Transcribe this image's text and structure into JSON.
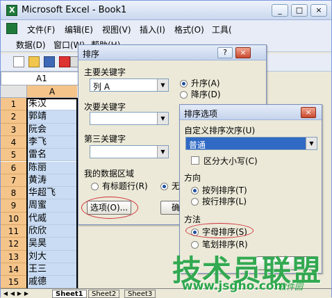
{
  "window": {
    "title": "Microsoft Excel - Book1",
    "caption_buttons": [
      "_",
      "□",
      "×"
    ]
  },
  "menubar": {
    "row1": [
      "文件(F)",
      "编辑(E)",
      "视图(V)",
      "插入(I)",
      "格式(O)",
      "工具("
    ],
    "row2": [
      "数据(D)",
      "窗口(W)",
      "帮助(H)"
    ]
  },
  "namebox": {
    "value": "A1"
  },
  "grid": {
    "column_header": "A",
    "rows": [
      {
        "n": "1",
        "v": "朱汉"
      },
      {
        "n": "2",
        "v": "郭靖"
      },
      {
        "n": "3",
        "v": "阮会"
      },
      {
        "n": "4",
        "v": "李飞"
      },
      {
        "n": "5",
        "v": "雷名"
      },
      {
        "n": "6",
        "v": "陈丽"
      },
      {
        "n": "7",
        "v": "黄涛"
      },
      {
        "n": "8",
        "v": "华超飞"
      },
      {
        "n": "9",
        "v": "周蜜"
      },
      {
        "n": "10",
        "v": "代威"
      },
      {
        "n": "11",
        "v": "欣欣"
      },
      {
        "n": "12",
        "v": "吴昊"
      },
      {
        "n": "13",
        "v": "刘大"
      },
      {
        "n": "14",
        "v": "王三"
      },
      {
        "n": "15",
        "v": "戚德"
      }
    ]
  },
  "sheet_tabs": [
    "Sheet1",
    "Sheet2",
    "Sheet3"
  ],
  "sort_dialog": {
    "title": "排序",
    "title_buttons": [
      "?",
      "×"
    ],
    "primary_key_label": "主要关键字",
    "primary_key_value": "列 A",
    "secondary_key_label": "次要关键字",
    "tertiary_key_label": "第三关键字",
    "asc": "升序(A)",
    "desc": "降序(D)",
    "region_label": "我的数据区域",
    "has_header": "有标题行(R)",
    "no_header": "无标",
    "options_button": "选项(O)...",
    "ok_button": "确定"
  },
  "options_dialog": {
    "title": "排序选项",
    "close": "×",
    "custom_order_label": "自定义排序次序(U)",
    "custom_order_value": "普通",
    "case_sensitive": "区分大小写(C)",
    "direction_label": "方向",
    "by_column": "按列排序(T)",
    "by_row": "按行排序(L)",
    "method_label": "方法",
    "alphabetical": "字母排序(S)",
    "by_stroke": "笔划排序(R)"
  },
  "watermark": {
    "main": "技术员联盟",
    "url": "www.jsgho.com",
    "tag": "软件园"
  },
  "colors": {
    "row_header": "#f4c48a",
    "selection": "#c9dcf3",
    "highlight_oval": "#d0303a",
    "watermark": "#2aa64a"
  }
}
